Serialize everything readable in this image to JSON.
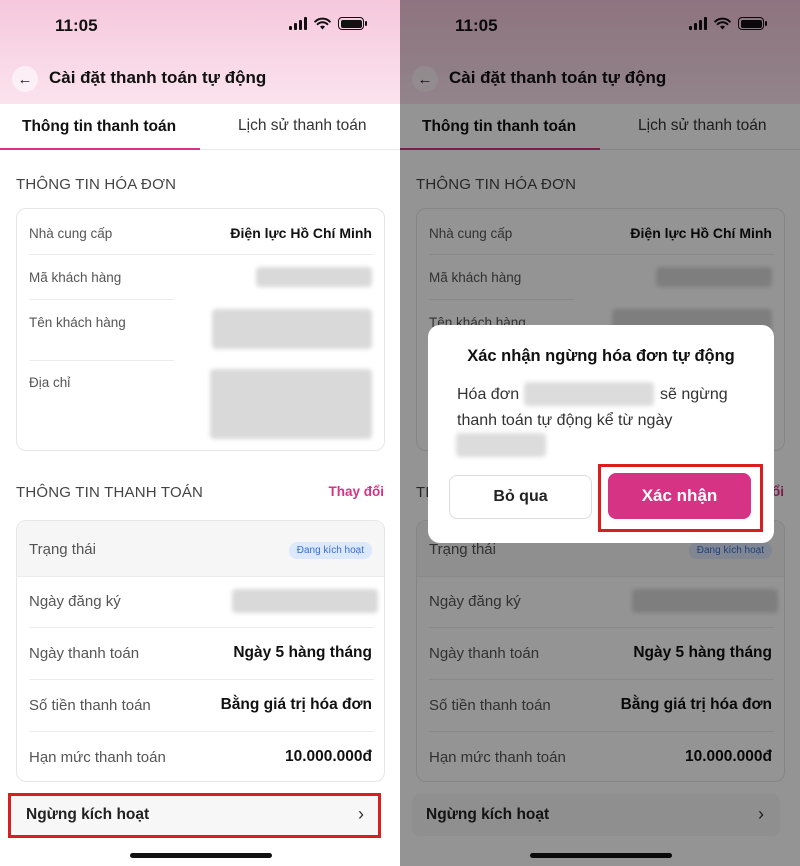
{
  "status_bar": {
    "time": "11:05"
  },
  "nav": {
    "title": "Cài đặt thanh toán tự động"
  },
  "tabs": [
    {
      "label": "Thông tin thanh toán"
    },
    {
      "label": "Lịch sử thanh toán"
    }
  ],
  "invoice_section": {
    "title": "THÔNG TIN HÓA ĐƠN",
    "rows": [
      {
        "label": "Nhà cung cấp",
        "value": "Điện lực Hồ Chí Minh"
      },
      {
        "label": "Mã khách hàng",
        "value": ""
      },
      {
        "label": "Tên khách hàng",
        "value": ""
      },
      {
        "label": "Địa chỉ",
        "value": ""
      }
    ]
  },
  "payment_section": {
    "title": "THÔNG TIN THANH TOÁN",
    "change_label": "Thay đổi",
    "status_label": "Trạng thái",
    "status_badge": "Đang kích hoạt",
    "rows": [
      {
        "label": "Ngày đăng ký",
        "value": ""
      },
      {
        "label": "Ngày thanh toán",
        "value": "Ngày 5 hàng tháng"
      },
      {
        "label": "Số tiền thanh toán",
        "value": "Bằng giá trị hóa đơn"
      },
      {
        "label": "Hạn mức thanh toán",
        "value": "10.000.000đ"
      }
    ]
  },
  "deactivate": {
    "label": "Ngừng kích hoạt"
  },
  "dialog": {
    "title": "Xác nhận ngừng hóa đơn tự động",
    "line1_prefix": "Hóa đơn",
    "line1_suffix": "sẽ ngừng",
    "line2": "thanh toán tự động kể từ ngày",
    "skip_label": "Bỏ qua",
    "confirm_label": "Xác nhận"
  },
  "colors": {
    "accent": "#d63384",
    "highlight": "#d91e1e",
    "badge_bg": "#dce8fb"
  }
}
